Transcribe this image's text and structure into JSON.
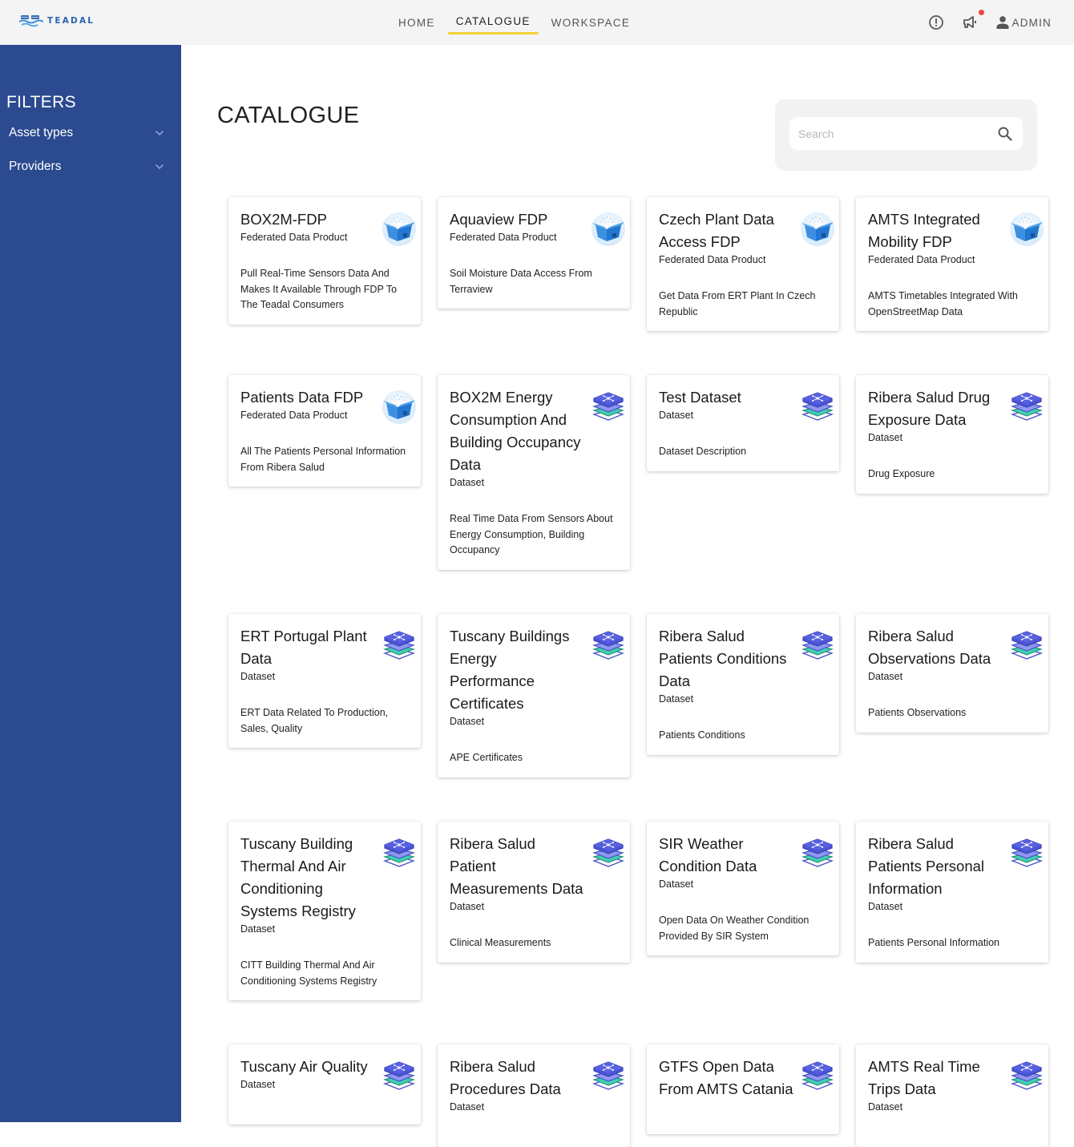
{
  "header": {
    "logo_text": "TEADAL",
    "nav": [
      {
        "label": "HOME",
        "active": false
      },
      {
        "label": "CATALOGUE",
        "active": true
      },
      {
        "label": "WORKSPACE",
        "active": false
      }
    ],
    "user_label": "ADMIN",
    "icons": [
      "info-icon",
      "announcement-icon",
      "user-icon"
    ],
    "notification_dot_color": "#e94545",
    "active_tab_underline_color": "#f3d23a"
  },
  "sidebar": {
    "title": "FILTERS",
    "filters": [
      {
        "label": "Asset types"
      },
      {
        "label": "Providers"
      }
    ],
    "background_color": "#2b4a8f"
  },
  "main": {
    "title": "CATALOGUE",
    "search": {
      "placeholder": "Search",
      "value": ""
    },
    "cards": [
      {
        "title": "BOX2M-FDP",
        "type": "Federated Data Product",
        "description": "Pull Real-Time Sensors Data And Makes It Available Through FDP To The Teadal Consumers",
        "icon": "box-icon"
      },
      {
        "title": "Aquaview FDP",
        "type": "Federated Data Product",
        "description": "Soil Moisture Data Access From Terraview",
        "icon": "box-icon"
      },
      {
        "title": "Czech Plant Data Access FDP",
        "type": "Federated Data Product",
        "description": "Get Data From ERT Plant In Czech Republic",
        "icon": "box-icon"
      },
      {
        "title": "AMTS Integrated Mobility FDP",
        "type": "Federated Data Product",
        "description": "AMTS Timetables Integrated With OpenStreetMap Data",
        "icon": "box-icon"
      },
      {
        "title": "Patients Data FDP",
        "type": "Federated Data Product",
        "description": "All The Patients Personal Information From Ribera Salud",
        "icon": "box-icon"
      },
      {
        "title": "BOX2M Energy Consumption And Building Occupancy Data",
        "type": "Dataset",
        "description": "Real Time Data From Sensors About Energy Consumption, Building Occupancy",
        "icon": "dataset-layers-icon"
      },
      {
        "title": "Test Dataset",
        "type": "Dataset",
        "description": "Dataset Description",
        "icon": "dataset-layers-icon"
      },
      {
        "title": "Ribera Salud Drug Exposure Data",
        "type": "Dataset",
        "description": "Drug Exposure",
        "icon": "dataset-layers-icon"
      },
      {
        "title": "ERT Portugal Plant Data",
        "type": "Dataset",
        "description": "ERT Data Related To Production, Sales, Quality",
        "icon": "dataset-layers-icon"
      },
      {
        "title": "Tuscany Buildings Energy Performance Certificates",
        "type": "Dataset",
        "description": "APE Certificates",
        "icon": "dataset-layers-icon"
      },
      {
        "title": "Ribera Salud Patients Conditions Data",
        "type": "Dataset",
        "description": "Patients Conditions",
        "icon": "dataset-layers-icon"
      },
      {
        "title": "Ribera Salud Observations Data",
        "type": "Dataset",
        "description": "Patients Observations",
        "icon": "dataset-layers-icon"
      },
      {
        "title": "Tuscany Building Thermal And Air Conditioning Systems Registry",
        "type": "Dataset",
        "description": "CITT Building Thermal And Air Conditioning Systems Registry",
        "icon": "dataset-layers-icon"
      },
      {
        "title": "Ribera Salud Patient Measurements Data",
        "type": "Dataset",
        "description": "Clinical Measurements",
        "icon": "dataset-layers-icon"
      },
      {
        "title": "SIR Weather Condition Data",
        "type": "Dataset",
        "description": "Open Data On Weather Condition Provided By SIR System",
        "icon": "dataset-layers-icon"
      },
      {
        "title": "Ribera Salud Patients Personal Information",
        "type": "Dataset",
        "description": "Patients Personal Information",
        "icon": "dataset-layers-icon"
      },
      {
        "title": "Tuscany Air Quality",
        "type": "Dataset",
        "description": "",
        "icon": "dataset-layers-icon"
      },
      {
        "title": "Ribera Salud Procedures Data",
        "type": "Dataset",
        "description": "",
        "icon": "dataset-layers-icon"
      },
      {
        "title": "GTFS Open Data From AMTS Catania",
        "type": "",
        "description": "",
        "icon": "dataset-layers-icon"
      },
      {
        "title": "AMTS Real Time Trips Data",
        "type": "Dataset",
        "description": "",
        "icon": "dataset-layers-icon"
      }
    ]
  }
}
